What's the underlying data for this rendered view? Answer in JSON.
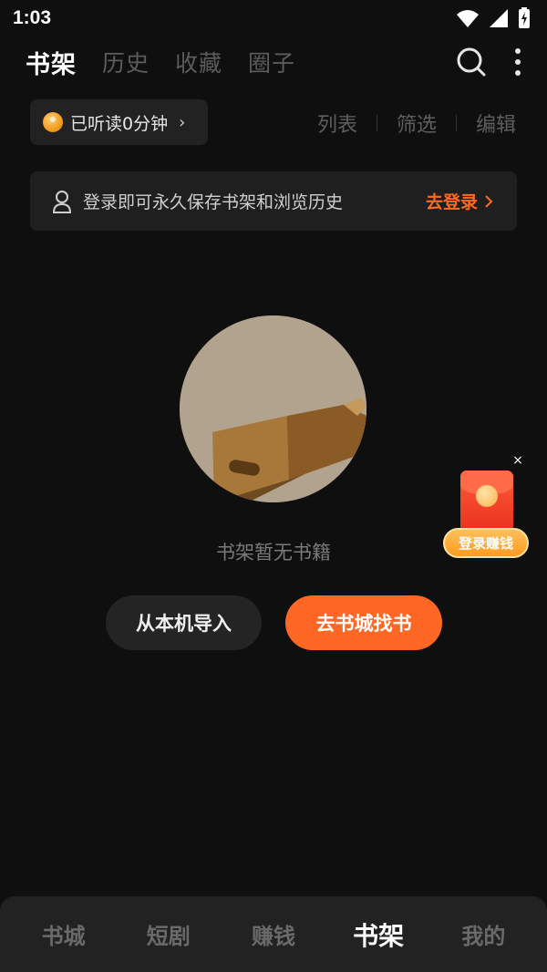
{
  "status_bar": {
    "time": "1:03",
    "icons": [
      "wifi-icon",
      "signal-icon",
      "battery-icon"
    ]
  },
  "top_tabs": [
    {
      "label": "书架",
      "active": true
    },
    {
      "label": "历史",
      "active": false
    },
    {
      "label": "收藏",
      "active": false
    },
    {
      "label": "圈子",
      "active": false
    }
  ],
  "top_actions": {
    "icons": [
      "search-icon",
      "more-vertical-icon"
    ]
  },
  "listen_chip": {
    "text": "已听读0分钟",
    "icon": "coin-icon"
  },
  "view_options": [
    "列表",
    "筛选",
    "编辑"
  ],
  "login_banner": {
    "message": "登录即可永久保存书架和浏览历史",
    "link": "去登录",
    "icon": "user-icon"
  },
  "empty_state": {
    "text": "书架暂无书籍",
    "illustration": "empty-box"
  },
  "buttons": {
    "import": "从本机导入",
    "store": "去书城找书"
  },
  "float_promo": {
    "label": "登录赚钱",
    "close": "×"
  },
  "bottom_nav": [
    {
      "label": "书城",
      "active": false
    },
    {
      "label": "短剧",
      "active": false
    },
    {
      "label": "赚钱",
      "active": false
    },
    {
      "label": "书架",
      "active": true
    },
    {
      "label": "我的",
      "active": false
    }
  ],
  "colors": {
    "accent": "#ff6824",
    "background": "#0f0f0f",
    "card": "#1f1f1f"
  }
}
